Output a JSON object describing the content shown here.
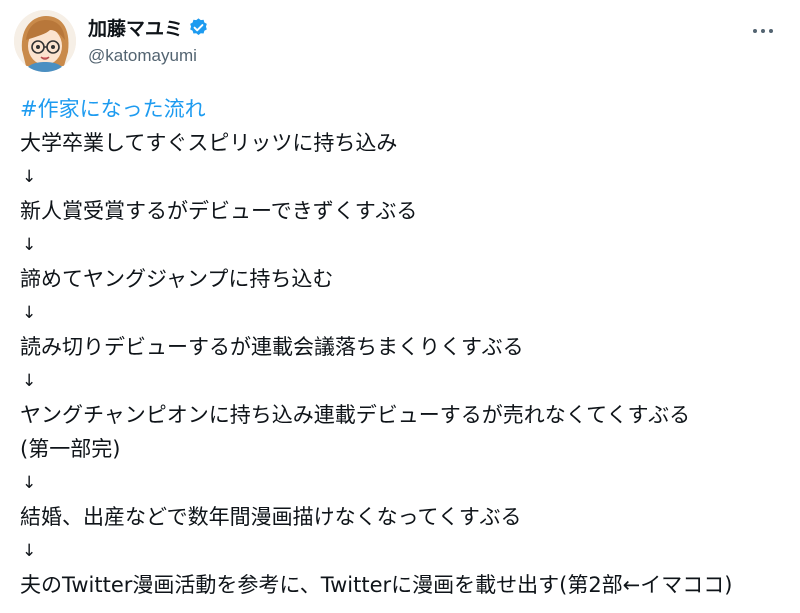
{
  "user": {
    "display_name": "加藤マユミ",
    "handle": "@katomayumi",
    "verified": true
  },
  "icons": {
    "verified": "verified-badge-icon",
    "more": "more-options-icon"
  },
  "colors": {
    "link": "#1d9bf0",
    "verified": "#1d9bf0",
    "text": "#0f1419",
    "secondary": "#536471"
  },
  "tweet": {
    "hashtag": "#作家になった流れ",
    "lines": [
      "大学卒業してすぐスピリッツに持ち込み",
      "↓",
      "新人賞受賞するがデビューできずくすぶる",
      "↓",
      "諦めてヤングジャンプに持ち込む",
      "↓",
      "読み切りデビューするが連載会議落ちまくりくすぶる",
      "↓",
      "ヤングチャンピオンに持ち込み連載デビューするが売れなくてくすぶる",
      "(第一部完)",
      "↓",
      "結婚、出産などで数年間漫画描けなくなってくすぶる",
      "↓",
      "夫のTwitter漫画活動を参考に、Twitterに漫画を載せ出す(第2部←イマココ)"
    ]
  }
}
